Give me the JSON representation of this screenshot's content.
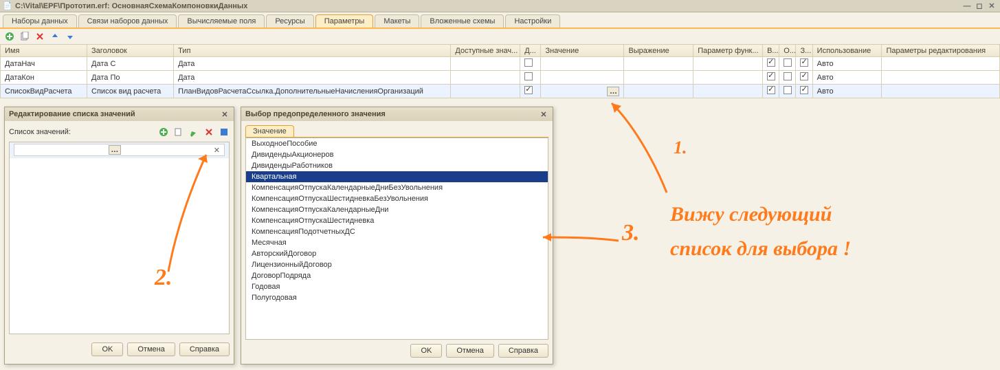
{
  "window": {
    "title": "C:\\Vital\\EPF\\Прототип.erf: ОсновнаяСхемаКомпоновкиДанных"
  },
  "tabs": {
    "datasets": "Наборы данных",
    "relations": "Связи наборов данных",
    "calc": "Вычисляемые поля",
    "resources": "Ресурсы",
    "params": "Параметры",
    "layouts": "Макеты",
    "nested": "Вложенные схемы",
    "settings": "Настройки"
  },
  "columns": {
    "name": "Имя",
    "header": "Заголовок",
    "type": "Тип",
    "avail": "Доступные знач...",
    "d": "Д...",
    "value": "Значение",
    "expr": "Выражение",
    "pfunc": "Параметр функ...",
    "v": "В...",
    "o": "О...",
    "z": "З...",
    "use": "Использование",
    "edit": "Параметры редактирования"
  },
  "rows": [
    {
      "name": "ДатаНач",
      "header": "Дата С",
      "type": "Дата",
      "avail": "",
      "d": false,
      "value": "",
      "expr": "",
      "pfunc": "",
      "v": true,
      "o": false,
      "z": true,
      "use": "Авто",
      "edit": ""
    },
    {
      "name": "ДатаКон",
      "header": "Дата По",
      "type": "Дата",
      "avail": "",
      "d": false,
      "value": "",
      "expr": "",
      "pfunc": "",
      "v": true,
      "o": false,
      "z": true,
      "use": "Авто",
      "edit": ""
    },
    {
      "name": "СписокВидРасчета",
      "header": "Список вид расчета",
      "type": "ПланВидовРасчетаСсылка.ДополнительныеНачисленияОрганизаций",
      "avail": "",
      "d": true,
      "value": "",
      "expr": "",
      "pfunc": "",
      "v": true,
      "o": false,
      "z": true,
      "use": "Авто",
      "edit": ""
    }
  ],
  "dlg1": {
    "title": "Редактирование списка значений",
    "label": "Список значений:",
    "ok": "OK",
    "cancel": "Отмена",
    "help": "Справка"
  },
  "dlg2": {
    "title": "Выбор предопределенного значения",
    "tab": "Значение",
    "items": [
      "ВыходноеПособие",
      "ДивидендыАкционеров",
      "ДивидендыРаботников",
      "Квартальная",
      "КомпенсацияОтпускаКалендарныеДниБезУвольнения",
      "КомпенсацияОтпускаШестидневкаБезУвольнения",
      "КомпенсацияОтпускаКалендарныеДни",
      "КомпенсацияОтпускаШестидневка",
      "КомпенсацияПодотчетныхДС",
      "Месячная",
      "АвторскийДоговор",
      "ЛицензионныйДоговор",
      "ДоговорПодряда",
      "Годовая",
      "Полугодовая"
    ],
    "selected_index": 3,
    "ok": "OK",
    "cancel": "Отмена",
    "help": "Справка"
  },
  "annotations": {
    "n1": "1.",
    "n2": "2.",
    "n3": "3.",
    "text1": "Вижу следующий",
    "text2": "список для выбора !"
  }
}
